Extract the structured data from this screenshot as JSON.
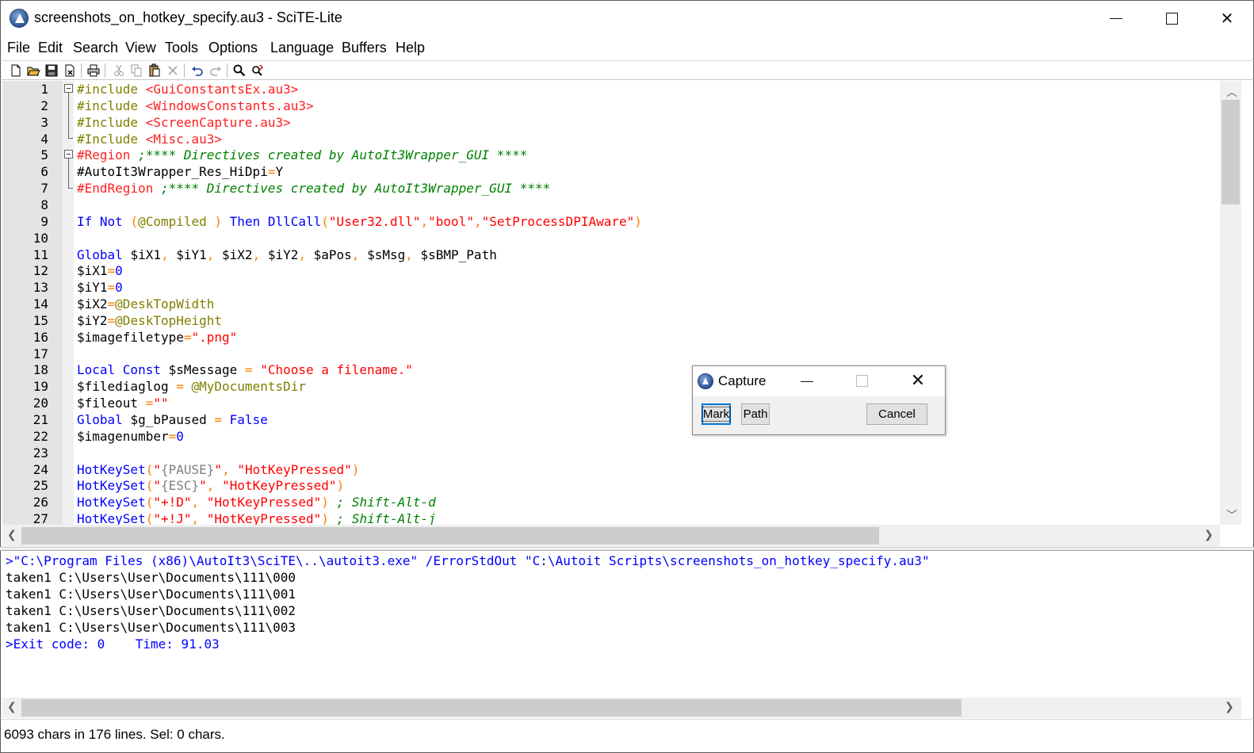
{
  "window": {
    "title": "screenshots_on_hotkey_specify.au3 - SciTE-Lite",
    "min_glyph": "",
    "close_glyph": "✕"
  },
  "menu": [
    "File",
    "Edit",
    "Search",
    "View",
    "Tools",
    "Options",
    "Language",
    "Buffers",
    "Help"
  ],
  "toolbar_icons": [
    "new-icon",
    "open-icon",
    "save-icon",
    "close-file-icon",
    "print-icon",
    "cut-icon",
    "copy-icon",
    "paste-icon",
    "delete-icon",
    "undo-icon",
    "redo-icon",
    "find-icon",
    "replace-icon"
  ],
  "editor": {
    "line_numbers": [
      "1",
      "2",
      "3",
      "4",
      "5",
      "6",
      "7",
      "8",
      "9",
      "10",
      "11",
      "12",
      "13",
      "14",
      "15",
      "16",
      "17",
      "18",
      "19",
      "20",
      "21",
      "22",
      "23",
      "24",
      "25",
      "26",
      "27"
    ],
    "lines": [
      [
        [
          "c-pre",
          "#include "
        ],
        [
          "c-inc",
          "<GuiConstantsEx.au3>"
        ]
      ],
      [
        [
          "c-pre",
          "#include "
        ],
        [
          "c-inc",
          "<WindowsConstants.au3>"
        ]
      ],
      [
        [
          "c-pre",
          "#Include "
        ],
        [
          "c-inc",
          "<ScreenCapture.au3>"
        ]
      ],
      [
        [
          "c-pre",
          "#Include "
        ],
        [
          "c-inc",
          "<Misc.au3>"
        ]
      ],
      [
        [
          "c-inc",
          "#Region "
        ],
        [
          "c-com",
          ";**** Directives created by AutoIt3Wrapper_GUI ****"
        ]
      ],
      [
        [
          "c-def",
          "#AutoIt3Wrapper_Res_HiDpi"
        ],
        [
          "c-op",
          "="
        ],
        [
          "c-def",
          "Y"
        ]
      ],
      [
        [
          "c-inc",
          "#EndRegion "
        ],
        [
          "c-com",
          ";**** Directives created by AutoIt3Wrapper_GUI ****"
        ]
      ],
      [],
      [
        [
          "c-kw",
          "If Not "
        ],
        [
          "c-op",
          "("
        ],
        [
          "c-mac",
          "@Compiled "
        ],
        [
          "c-op",
          ") "
        ],
        [
          "c-kw",
          "Then "
        ],
        [
          "c-fn",
          "DllCall"
        ],
        [
          "c-op",
          "("
        ],
        [
          "c-str",
          "\"User32.dll\""
        ],
        [
          "c-op",
          ","
        ],
        [
          "c-str",
          "\"bool\""
        ],
        [
          "c-op",
          ","
        ],
        [
          "c-str",
          "\"SetProcessDPIAware\""
        ],
        [
          "c-op",
          ")"
        ]
      ],
      [],
      [
        [
          "c-kw",
          "Global "
        ],
        [
          "c-var",
          "$iX1"
        ],
        [
          "c-op",
          ", "
        ],
        [
          "c-var",
          "$iY1"
        ],
        [
          "c-op",
          ", "
        ],
        [
          "c-var",
          "$iX2"
        ],
        [
          "c-op",
          ", "
        ],
        [
          "c-var",
          "$iY2"
        ],
        [
          "c-op",
          ", "
        ],
        [
          "c-var",
          "$aPos"
        ],
        [
          "c-op",
          ", "
        ],
        [
          "c-var",
          "$sMsg"
        ],
        [
          "c-op",
          ", "
        ],
        [
          "c-var",
          "$sBMP_Path"
        ]
      ],
      [
        [
          "c-var",
          "$iX1"
        ],
        [
          "c-op",
          "="
        ],
        [
          "c-num",
          "0"
        ]
      ],
      [
        [
          "c-var",
          "$iY1"
        ],
        [
          "c-op",
          "="
        ],
        [
          "c-num",
          "0"
        ]
      ],
      [
        [
          "c-var",
          "$iX2"
        ],
        [
          "c-op",
          "="
        ],
        [
          "c-mac",
          "@DeskTopWidth"
        ]
      ],
      [
        [
          "c-var",
          "$iY2"
        ],
        [
          "c-op",
          "="
        ],
        [
          "c-mac",
          "@DeskTopHeight"
        ]
      ],
      [
        [
          "c-var",
          "$imagefiletype"
        ],
        [
          "c-op",
          "="
        ],
        [
          "c-str",
          "\".png\""
        ]
      ],
      [],
      [
        [
          "c-kw",
          "Local Const "
        ],
        [
          "c-var",
          "$sMessage "
        ],
        [
          "c-op",
          "= "
        ],
        [
          "c-str",
          "\"Choose a filename.\""
        ]
      ],
      [
        [
          "c-var",
          "$filediaglog "
        ],
        [
          "c-op",
          "= "
        ],
        [
          "c-mac",
          "@MyDocumentsDir"
        ]
      ],
      [
        [
          "c-var",
          "$fileout "
        ],
        [
          "c-op",
          "="
        ],
        [
          "c-str",
          "\"\""
        ]
      ],
      [
        [
          "c-kw",
          "Global "
        ],
        [
          "c-var",
          "$g_bPaused "
        ],
        [
          "c-op",
          "= "
        ],
        [
          "c-kw",
          "False"
        ]
      ],
      [
        [
          "c-var",
          "$imagenumber"
        ],
        [
          "c-op",
          "="
        ],
        [
          "c-num",
          "0"
        ]
      ],
      [],
      [
        [
          "c-fn",
          "HotKeySet"
        ],
        [
          "c-op",
          "("
        ],
        [
          "c-str",
          "\""
        ],
        [
          "c-send",
          "{PAUSE}"
        ],
        [
          "c-str",
          "\""
        ],
        [
          "c-op",
          ", "
        ],
        [
          "c-str",
          "\"HotKeyPressed\""
        ],
        [
          "c-op",
          ")"
        ]
      ],
      [
        [
          "c-fn",
          "HotKeySet"
        ],
        [
          "c-op",
          "("
        ],
        [
          "c-str",
          "\""
        ],
        [
          "c-send",
          "{ESC}"
        ],
        [
          "c-str",
          "\""
        ],
        [
          "c-op",
          ", "
        ],
        [
          "c-str",
          "\"HotKeyPressed\""
        ],
        [
          "c-op",
          ")"
        ]
      ],
      [
        [
          "c-fn",
          "HotKeySet"
        ],
        [
          "c-op",
          "("
        ],
        [
          "c-str",
          "\"+!D\""
        ],
        [
          "c-op",
          ", "
        ],
        [
          "c-str",
          "\"HotKeyPressed\""
        ],
        [
          "c-op",
          ") "
        ],
        [
          "c-com",
          "; Shift-Alt-d"
        ]
      ],
      [
        [
          "c-fn",
          "HotKeySet"
        ],
        [
          "c-op",
          "("
        ],
        [
          "c-str",
          "\"+!J\""
        ],
        [
          "c-op",
          ", "
        ],
        [
          "c-str",
          "\"HotKeyPressed\""
        ],
        [
          "c-op",
          ") "
        ],
        [
          "c-com",
          "; Shift-Alt-j"
        ]
      ]
    ]
  },
  "output": {
    "lines": [
      {
        "cls": "out-blue",
        "text": ">\"C:\\Program Files (x86)\\AutoIt3\\SciTE\\..\\autoit3.exe\" /ErrorStdOut \"C:\\Autoit Scripts\\screenshots_on_hotkey_specify.au3\""
      },
      {
        "cls": "",
        "text": "taken1 C:\\Users\\User\\Documents\\111\\000"
      },
      {
        "cls": "",
        "text": "taken1 C:\\Users\\User\\Documents\\111\\001"
      },
      {
        "cls": "",
        "text": "taken1 C:\\Users\\User\\Documents\\111\\002"
      },
      {
        "cls": "",
        "text": "taken1 C:\\Users\\User\\Documents\\111\\003"
      },
      {
        "cls": "out-blue",
        "text": ">Exit code: 0    Time: 91.03"
      }
    ]
  },
  "status": {
    "text": "6093 chars in 176 lines. Sel: 0 chars."
  },
  "capture_dialog": {
    "title": "Capture",
    "mark_label": "Mark",
    "path_label": "Path",
    "cancel_label": "Cancel"
  }
}
